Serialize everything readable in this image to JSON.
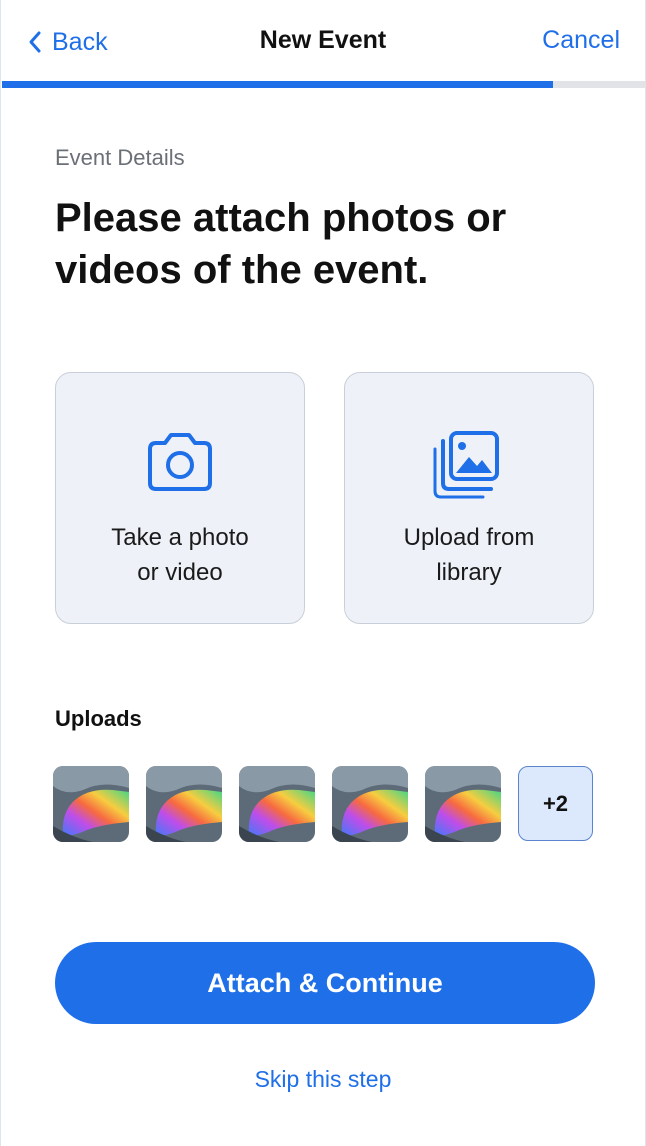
{
  "nav": {
    "back_label": "Back",
    "title": "New Event",
    "cancel_label": "Cancel"
  },
  "progress": {
    "fraction": 0.855
  },
  "content": {
    "section_label": "Event Details",
    "headline": "Please attach photos or videos of the event."
  },
  "options": [
    {
      "label": "Take a photo\nor video",
      "icon": "camera-icon"
    },
    {
      "label": "Upload from\nlibrary",
      "icon": "photo-library-icon"
    }
  ],
  "uploads": {
    "label": "Uploads",
    "thumbnail_count": 5,
    "more_label": "+2"
  },
  "actions": {
    "primary_label": "Attach & Continue",
    "skip_label": "Skip this step"
  },
  "colors": {
    "accent": "#1f6fe8",
    "tile_bg": "#eef2f8",
    "badge_bg": "#dce8fb"
  }
}
